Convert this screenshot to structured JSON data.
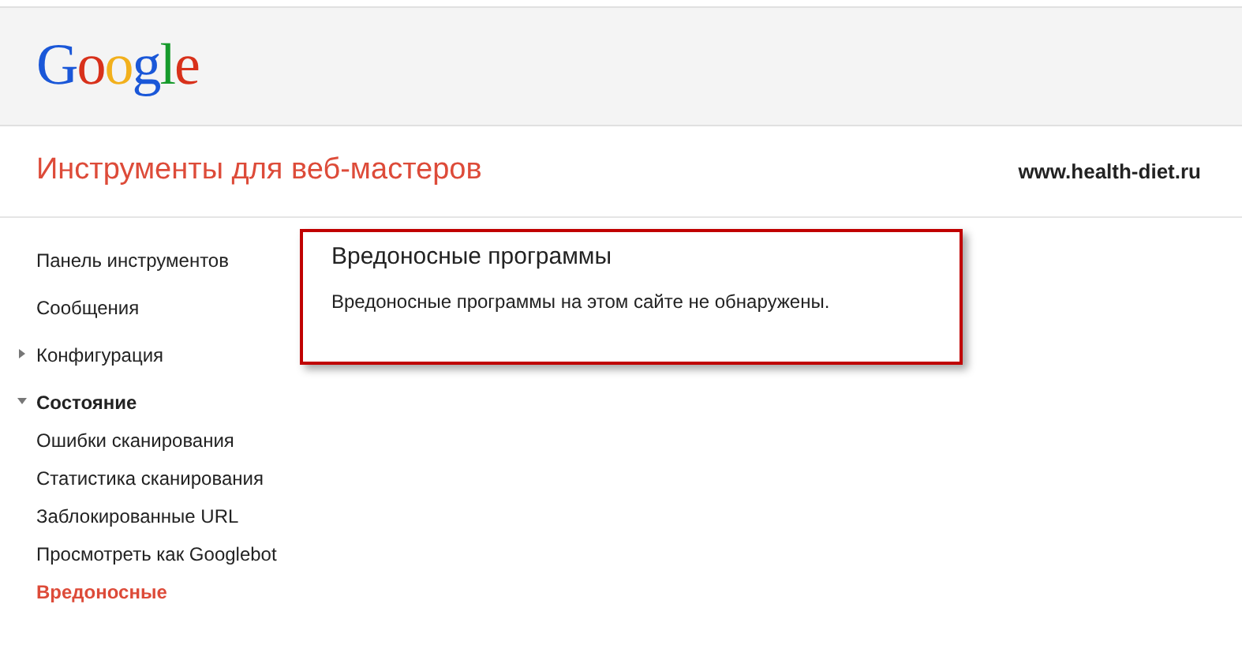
{
  "header": {
    "logo": "Google"
  },
  "title_bar": {
    "title": "Инструменты для веб-мастеров",
    "site": "www.health-diet.ru"
  },
  "sidebar": {
    "items": [
      {
        "label": "Панель инструментов",
        "selected": false
      },
      {
        "label": "Сообщения",
        "selected": false
      },
      {
        "label": "Конфигурация",
        "selected": false,
        "expanded": false
      },
      {
        "label": "Состояние",
        "selected": false,
        "expanded": true,
        "children": [
          {
            "label": "Ошибки сканирования",
            "selected": false
          },
          {
            "label": "Статистика сканирования",
            "selected": false
          },
          {
            "label": "Заблокированные URL",
            "selected": false
          },
          {
            "label": "Просмотреть как Googlebot",
            "selected": false
          },
          {
            "label": "Вредоносные",
            "selected": true
          }
        ]
      }
    ]
  },
  "panel": {
    "title": "Вредоносные программы",
    "message": "Вредоносные программы на этом сайте не обнаружены."
  }
}
